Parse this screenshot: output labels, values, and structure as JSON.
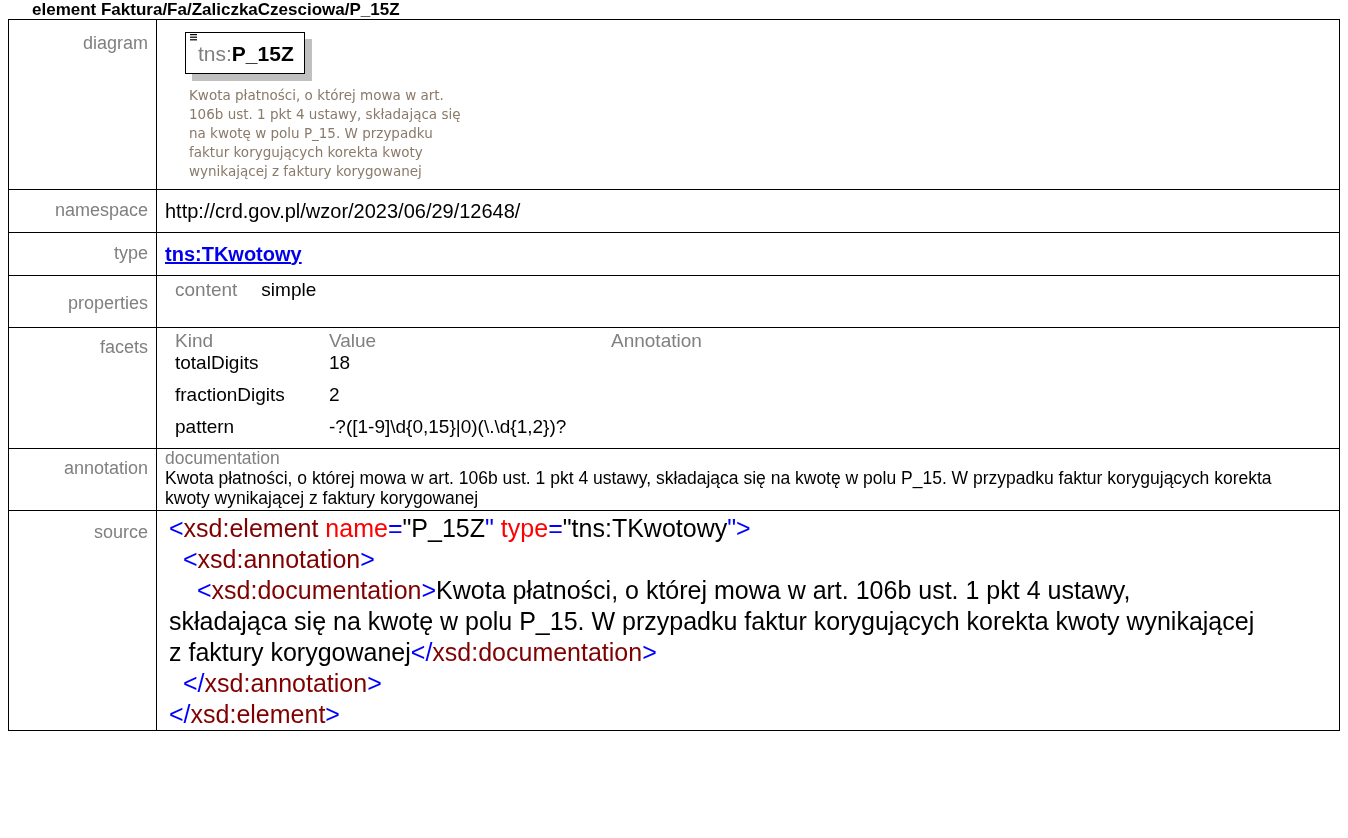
{
  "title": "element Faktura/Fa/ZaliczkaCzesciowa/P_15Z",
  "rows": [
    {
      "kind": "diagram",
      "label": "diagram",
      "element": {
        "prefix": "tns:",
        "name": "P_15Z"
      },
      "documentation": "Kwota płatności, o której mowa w art. 106b ust. 1 pkt 4 ustawy, składająca się na kwotę w polu P_15. W przypadku faktur korygujących korekta kwoty wynikającej z faktury korygowanej"
    },
    {
      "kind": "text",
      "label": "namespace",
      "value": "http://crd.gov.pl/wzor/2023/06/29/12648/"
    },
    {
      "kind": "link",
      "label": "type",
      "value": "tns:TKwotowy"
    },
    {
      "kind": "properties",
      "label": "properties",
      "items": [
        {
          "name": "content",
          "value": "simple"
        }
      ]
    },
    {
      "kind": "facets",
      "label": "facets",
      "columns": [
        "Kind",
        "Value",
        "Annotation"
      ],
      "facets": [
        {
          "kind": "totalDigits",
          "value": "18"
        },
        {
          "kind": "fractionDigits",
          "value": "2"
        },
        {
          "kind": "pattern",
          "value": "-?([1-9]\\d{0,15}|0)(\\.\\d{1,2})?"
        }
      ]
    },
    {
      "kind": "annotation",
      "label": "annotation",
      "heading": "documentation",
      "text": "Kwota płatności, o której mowa w art. 106b ust. 1 pkt 4 ustawy, składająca się na kwotę w polu P_15. W przypadku faktur korygujących korekta kwoty wynikającej z faktury korygowanej"
    },
    {
      "kind": "source",
      "label": "source",
      "lines": [
        {
          "tokens": [
            {
              "kind": "punct",
              "text": "<"
            },
            {
              "kind": "tag",
              "text": "xsd:element"
            },
            {
              "kind": "attr",
              "text": " name"
            },
            {
              "kind": "punct",
              "text": "="
            },
            {
              "kind": "text",
              "text": "\"P_15Z"
            },
            {
              "kind": "punct",
              "text": "\""
            },
            {
              "kind": "attr",
              "text": " type"
            },
            {
              "kind": "punct",
              "text": "="
            },
            {
              "kind": "text",
              "text": "\"tns:TKwotowy"
            },
            {
              "kind": "punct",
              "text": "\">"
            }
          ],
          "children": [
            {
              "tokens": [
                {
                  "kind": "punct",
                  "text": "<"
                },
                {
                  "kind": "tag",
                  "text": "xsd:annotation"
                },
                {
                  "kind": "punct",
                  "text": ">"
                }
              ],
              "children": [
                {
                  "tokens": [
                    {
                      "kind": "punct",
                      "text": "<"
                    },
                    {
                      "kind": "tag",
                      "text": "xsd:documentation"
                    },
                    {
                      "kind": "punct",
                      "text": ">"
                    },
                    {
                      "kind": "text",
                      "text": "Kwota płatności, o której mowa w art. 106b ust. 1 pkt 4 ustawy,\nskładająca się na kwotę w polu P_15. W przypadku faktur korygujących korekta kwoty wynikającej\nz faktury korygowanej"
                    },
                    {
                      "kind": "punct",
                      "text": "</"
                    },
                    {
                      "kind": "tag",
                      "text": "xsd:documentation"
                    },
                    {
                      "kind": "punct",
                      "text": ">"
                    }
                  ]
                }
              ]
            },
            {
              "tokens": [
                {
                  "kind": "punct",
                  "text": "</"
                },
                {
                  "kind": "tag",
                  "text": "xsd:annotation"
                },
                {
                  "kind": "punct",
                  "text": ">"
                }
              ]
            }
          ]
        },
        {
          "tokens": [
            {
              "kind": "punct",
              "text": "</"
            },
            {
              "kind": "tag",
              "text": "xsd:element"
            },
            {
              "kind": "punct",
              "text": ">"
            }
          ]
        }
      ]
    }
  ]
}
